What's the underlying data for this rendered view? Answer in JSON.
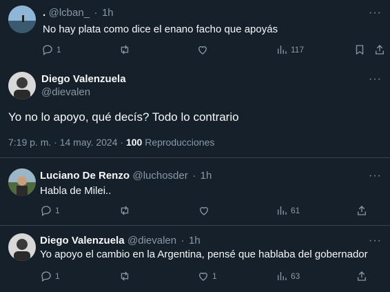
{
  "tweets": [
    {
      "author_name": ".",
      "handle": "@lcban_",
      "time": "1h",
      "text": "No hay plata como dice el enano facho que apoyás",
      "replies": "1",
      "views": "117"
    },
    {
      "author_name": "Diego Valenzuela",
      "handle": "@dievalen",
      "text": "Yo no lo apoyo, qué decís? Todo lo contrario",
      "timestamp": "7:19 p. m. · 14 may. 2024",
      "meta_sep": "·",
      "views_count": "100",
      "views_label": "Reproducciones"
    },
    {
      "author_name": "Luciano De Renzo",
      "handle": "@luchosder",
      "time": "1h",
      "text": "Habla de Milei..",
      "replies": "1",
      "views": "61"
    },
    {
      "author_name": "Diego Valenzuela",
      "handle": "@dievalen",
      "time": "1h",
      "text": "Yo apoyo el cambio en la Argentina, pensé que hablaba del gobernador",
      "replies": "1",
      "likes": "1",
      "views": "63"
    }
  ],
  "separator": "·",
  "more_label": "···",
  "colors": {
    "background": "#15202b",
    "divider": "#38444d",
    "secondary_text": "#8b98a5",
    "primary_text": "#f7f9f9"
  }
}
